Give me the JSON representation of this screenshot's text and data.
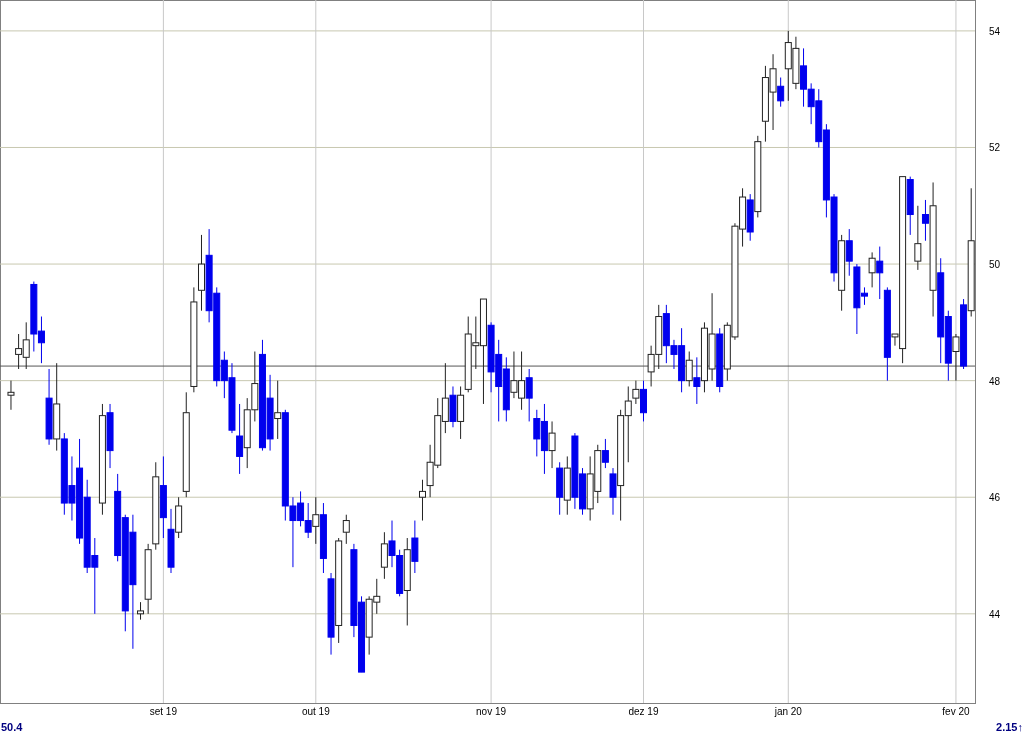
{
  "chart": {
    "chart_data": {
      "type": "candlestick",
      "categories": [
        null,
        null,
        null,
        null,
        null,
        null,
        null,
        null,
        null,
        null,
        null,
        null,
        null,
        null,
        null,
        null,
        null,
        null,
        null,
        null,
        "set 19",
        null,
        null,
        null,
        null,
        null,
        null,
        null,
        null,
        null,
        null,
        null,
        null,
        null,
        null,
        null,
        null,
        null,
        null,
        null,
        "out 19",
        null,
        null,
        null,
        null,
        null,
        null,
        null,
        null,
        null,
        null,
        null,
        null,
        null,
        null,
        null,
        null,
        null,
        null,
        null,
        null,
        null,
        null,
        "nov 19",
        null,
        null,
        null,
        null,
        null,
        null,
        null,
        null,
        null,
        null,
        null,
        null,
        null,
        null,
        null,
        null,
        null,
        null,
        null,
        "dez 19",
        null,
        null,
        null,
        null,
        null,
        null,
        null,
        null,
        null,
        null,
        null,
        null,
        null,
        null,
        null,
        null,
        null,
        null,
        "jan 20",
        null,
        null,
        null,
        null,
        null,
        null,
        null,
        null,
        null,
        null,
        null,
        null,
        null,
        null,
        null,
        null,
        null,
        null,
        null,
        null,
        null,
        "fev 20",
        null,
        null
      ],
      "ylim": [
        42.47,
        54.53
      ],
      "yticks": [
        44,
        46,
        48,
        50,
        52,
        54
      ],
      "grid": true,
      "ref_lines": [
        {
          "axis": "y",
          "value": 48.25
        }
      ],
      "ohlc": [
        [
          47.75,
          48.0,
          47.5,
          47.8
        ],
        [
          48.45,
          48.8,
          48.2,
          48.55
        ],
        [
          48.4,
          49.0,
          48.2,
          48.7
        ],
        [
          49.65,
          49.7,
          48.5,
          48.8
        ],
        [
          48.85,
          49.1,
          48.3,
          48.65
        ],
        [
          47.7,
          48.2,
          46.9,
          47.0
        ],
        [
          47.0,
          48.3,
          46.8,
          47.6
        ],
        [
          47.0,
          47.1,
          45.7,
          45.9
        ],
        [
          46.2,
          46.7,
          45.6,
          45.9
        ],
        [
          46.5,
          47.0,
          45.2,
          45.3
        ],
        [
          46.0,
          46.3,
          44.7,
          44.8
        ],
        [
          45.0,
          45.3,
          44.0,
          44.8
        ],
        [
          45.9,
          47.6,
          45.7,
          47.4
        ],
        [
          47.45,
          47.6,
          46.5,
          46.8
        ],
        [
          46.1,
          46.4,
          44.9,
          45.0
        ],
        [
          45.65,
          45.7,
          43.7,
          44.05
        ],
        [
          45.4,
          45.7,
          43.4,
          44.5
        ],
        [
          44.0,
          44.2,
          43.9,
          44.05
        ],
        [
          44.25,
          45.2,
          44.0,
          45.1
        ],
        [
          45.2,
          46.6,
          45.1,
          46.35
        ],
        [
          46.2,
          46.7,
          45.3,
          45.65
        ],
        [
          45.45,
          45.8,
          44.7,
          44.8
        ],
        [
          45.4,
          46.0,
          45.3,
          45.85
        ],
        [
          46.1,
          47.8,
          46.0,
          47.45
        ],
        [
          47.9,
          49.6,
          47.8,
          49.35
        ],
        [
          49.55,
          50.5,
          49.2,
          50.0
        ],
        [
          50.15,
          50.6,
          49.0,
          49.2
        ],
        [
          49.5,
          49.6,
          47.9,
          48.0
        ],
        [
          48.35,
          48.5,
          47.7,
          48.0
        ],
        [
          48.05,
          48.3,
          47.1,
          47.15
        ],
        [
          47.05,
          47.6,
          46.4,
          46.7
        ],
        [
          46.85,
          47.7,
          46.5,
          47.5
        ],
        [
          47.5,
          48.5,
          47.3,
          47.95
        ],
        [
          48.45,
          48.7,
          46.8,
          46.85
        ],
        [
          47.7,
          48.1,
          46.8,
          47.0
        ],
        [
          47.35,
          48.0,
          47.0,
          47.45
        ],
        [
          47.45,
          47.5,
          45.6,
          45.85
        ],
        [
          45.85,
          46.0,
          44.8,
          45.6
        ],
        [
          45.9,
          46.1,
          45.5,
          45.6
        ],
        [
          45.6,
          45.9,
          45.3,
          45.4
        ],
        [
          45.5,
          46.0,
          45.2,
          45.7
        ],
        [
          45.7,
          45.9,
          44.7,
          44.95
        ],
        [
          44.6,
          44.7,
          43.3,
          43.6
        ],
        [
          43.8,
          45.3,
          43.5,
          45.25
        ],
        [
          45.4,
          45.7,
          45.2,
          45.6
        ],
        [
          45.1,
          45.2,
          43.6,
          43.8
        ],
        [
          44.2,
          44.3,
          43.0,
          43.0
        ],
        [
          43.6,
          44.3,
          43.3,
          44.25
        ],
        [
          44.2,
          44.6,
          44.0,
          44.3
        ],
        [
          44.8,
          45.4,
          44.6,
          45.2
        ],
        [
          45.25,
          45.6,
          44.8,
          45.0
        ],
        [
          45.0,
          45.1,
          44.3,
          44.35
        ],
        [
          44.4,
          45.3,
          43.8,
          45.1
        ],
        [
          45.3,
          45.6,
          44.7,
          44.9
        ],
        [
          46.0,
          46.3,
          45.6,
          46.1
        ],
        [
          46.2,
          46.9,
          46.0,
          46.6
        ],
        [
          46.55,
          47.7,
          46.5,
          47.4
        ],
        [
          47.3,
          48.3,
          47.1,
          47.7
        ],
        [
          47.75,
          47.9,
          47.2,
          47.3
        ],
        [
          47.3,
          47.9,
          47.0,
          47.75
        ],
        [
          47.85,
          49.1,
          47.8,
          48.8
        ],
        [
          48.6,
          49.1,
          48.2,
          48.65
        ],
        [
          48.6,
          49.4,
          47.6,
          49.4
        ],
        [
          48.95,
          49.0,
          47.8,
          48.15
        ],
        [
          48.45,
          48.7,
          47.3,
          47.9
        ],
        [
          48.2,
          48.4,
          47.3,
          47.5
        ],
        [
          47.8,
          48.5,
          47.7,
          48.0
        ],
        [
          47.7,
          48.5,
          47.5,
          48.0
        ],
        [
          48.05,
          48.2,
          47.3,
          47.7
        ],
        [
          47.35,
          47.5,
          46.7,
          47.0
        ],
        [
          47.3,
          47.6,
          46.4,
          46.8
        ],
        [
          46.8,
          47.3,
          46.5,
          47.1
        ],
        [
          46.5,
          46.6,
          45.7,
          46.0
        ],
        [
          45.95,
          46.7,
          45.7,
          46.5
        ],
        [
          47.05,
          47.1,
          45.8,
          46.0
        ],
        [
          46.4,
          46.5,
          45.7,
          45.8
        ],
        [
          45.8,
          46.7,
          45.6,
          46.4
        ],
        [
          46.1,
          46.9,
          45.9,
          46.8
        ],
        [
          46.8,
          47.0,
          46.5,
          46.6
        ],
        [
          46.4,
          46.5,
          45.7,
          46.0
        ],
        [
          46.2,
          47.5,
          45.6,
          47.4
        ],
        [
          47.4,
          47.9,
          46.6,
          47.65
        ],
        [
          47.7,
          48.0,
          47.6,
          47.85
        ],
        [
          47.85,
          48.0,
          47.3,
          47.45
        ],
        [
          48.15,
          48.6,
          47.9,
          48.45
        ],
        [
          48.45,
          49.3,
          48.2,
          49.1
        ],
        [
          49.15,
          49.3,
          48.3,
          48.6
        ],
        [
          48.6,
          48.7,
          48.2,
          48.45
        ],
        [
          48.6,
          48.9,
          47.8,
          48.0
        ],
        [
          48.0,
          48.5,
          47.9,
          48.35
        ],
        [
          48.05,
          48.4,
          47.6,
          47.9
        ],
        [
          48.0,
          49.0,
          47.8,
          48.9
        ],
        [
          48.2,
          49.5,
          48.0,
          48.8
        ],
        [
          48.8,
          48.9,
          47.8,
          47.9
        ],
        [
          48.2,
          49.0,
          48.0,
          48.95
        ],
        [
          48.75,
          50.7,
          48.7,
          50.65
        ],
        [
          50.6,
          51.3,
          50.3,
          51.15
        ],
        [
          51.1,
          51.2,
          50.4,
          50.55
        ],
        [
          50.9,
          52.2,
          50.8,
          52.1
        ],
        [
          52.45,
          53.4,
          52.1,
          53.2
        ],
        [
          52.95,
          53.6,
          52.3,
          53.35
        ],
        [
          53.05,
          53.2,
          52.7,
          52.8
        ],
        [
          53.35,
          54.0,
          52.8,
          53.8
        ],
        [
          53.1,
          53.9,
          53.0,
          53.7
        ],
        [
          53.4,
          53.7,
          52.7,
          53.0
        ],
        [
          53.0,
          53.1,
          52.4,
          52.7
        ],
        [
          52.8,
          53.0,
          52.0,
          52.1
        ],
        [
          52.3,
          52.4,
          50.8,
          51.1
        ],
        [
          51.15,
          51.2,
          49.7,
          49.85
        ],
        [
          49.55,
          50.5,
          49.2,
          50.4
        ],
        [
          50.4,
          50.6,
          49.8,
          50.05
        ],
        [
          49.95,
          50.0,
          48.8,
          49.25
        ],
        [
          49.5,
          49.6,
          49.3,
          49.45
        ],
        [
          49.85,
          50.2,
          49.6,
          50.1
        ],
        [
          50.05,
          50.3,
          49.4,
          49.85
        ],
        [
          49.55,
          49.6,
          48.0,
          48.4
        ],
        [
          48.75,
          48.8,
          48.6,
          48.8
        ],
        [
          48.55,
          51.5,
          48.3,
          51.5
        ],
        [
          51.45,
          51.5,
          50.5,
          50.85
        ],
        [
          50.05,
          51.0,
          49.9,
          50.35
        ],
        [
          50.85,
          51.1,
          50.4,
          50.7
        ],
        [
          49.55,
          51.4,
          49.1,
          51.0
        ],
        [
          49.85,
          50.1,
          48.3,
          48.75
        ],
        [
          49.1,
          49.2,
          48.0,
          48.3
        ],
        [
          48.5,
          48.8,
          48.0,
          48.75
        ],
        [
          49.3,
          49.4,
          48.2,
          48.25
        ],
        [
          49.2,
          51.3,
          49.1,
          50.4
        ]
      ]
    }
  },
  "footer": {
    "left_value": "50.4",
    "right_value": "2.15↑"
  }
}
